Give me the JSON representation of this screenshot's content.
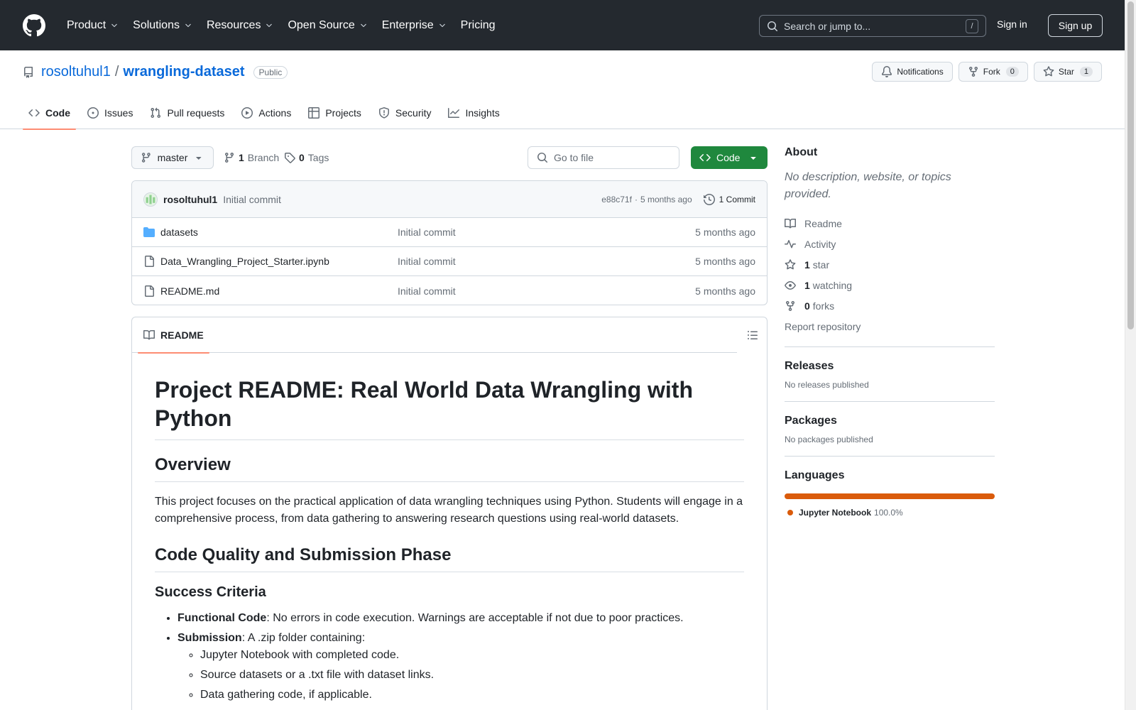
{
  "header": {
    "nav": [
      "Product",
      "Solutions",
      "Resources",
      "Open Source",
      "Enterprise",
      "Pricing"
    ],
    "search_placeholder": "Search or jump to...",
    "search_shortcut": "/",
    "sign_in": "Sign in",
    "sign_up": "Sign up"
  },
  "repo": {
    "owner": "rosoltuhul1",
    "separator": "/",
    "name": "wrangling-dataset",
    "visibility": "Public",
    "notifications_label": "Notifications",
    "fork_label": "Fork",
    "fork_count": "0",
    "star_label": "Star",
    "star_count": "1",
    "tabs": [
      "Code",
      "Issues",
      "Pull requests",
      "Actions",
      "Projects",
      "Security",
      "Insights"
    ]
  },
  "toolbar": {
    "branch": "master",
    "branch_count": "1",
    "branch_label": "Branch",
    "tag_count": "0",
    "tag_label": "Tags",
    "goto_placeholder": "Go to file",
    "code_button": "Code"
  },
  "commit": {
    "author": "rosoltuhul1",
    "message": "Initial commit",
    "hash": "e88c71f",
    "dot": "·",
    "age": "5 months ago",
    "commits_label": "1 Commit"
  },
  "files": [
    {
      "name": "datasets",
      "type": "folder",
      "commit": "Initial commit",
      "age": "5 months ago"
    },
    {
      "name": "Data_Wrangling_Project_Starter.ipynb",
      "type": "file",
      "commit": "Initial commit",
      "age": "5 months ago"
    },
    {
      "name": "README.md",
      "type": "file",
      "commit": "Initial commit",
      "age": "5 months ago"
    }
  ],
  "readme": {
    "tab_label": "README",
    "h1": "Project README: Real World Data Wrangling with Python",
    "overview_heading": "Overview",
    "overview_text": "This project focuses on the practical application of data wrangling techniques using Python. Students will engage in a comprehensive process, from data gathering to answering research questions using real-world datasets.",
    "phase_heading": "Code Quality and Submission Phase",
    "criteria_heading": "Success Criteria",
    "item1_bold": "Functional Code",
    "item1_text": ": No errors in code execution. Warnings are acceptable if not due to poor practices.",
    "item2_bold": "Submission",
    "item2_text": ": A .zip folder containing:",
    "subitems": [
      "Jupyter Notebook with completed code.",
      "Source datasets or a .txt file with dataset links.",
      "Data gathering code, if applicable."
    ]
  },
  "sidebar": {
    "about_heading": "About",
    "about_desc": "No description, website, or topics provided.",
    "readme_link": "Readme",
    "activity_link": "Activity",
    "stars_count": "1",
    "stars_label": "star",
    "watching_count": "1",
    "watching_label": "watching",
    "forks_count": "0",
    "forks_label": "forks",
    "report_link": "Report repository",
    "releases_heading": "Releases",
    "releases_text": "No releases published",
    "packages_heading": "Packages",
    "packages_text": "No packages published",
    "languages_heading": "Languages",
    "language_name": "Jupyter Notebook",
    "language_pct": "100.0%",
    "language_share": 1.0,
    "language_color": "#da5b0b"
  },
  "colors": {
    "header_bg": "#24292f",
    "link": "#0969da",
    "primary_button": "#1f883d",
    "tab_underline": "#fd8c73"
  }
}
